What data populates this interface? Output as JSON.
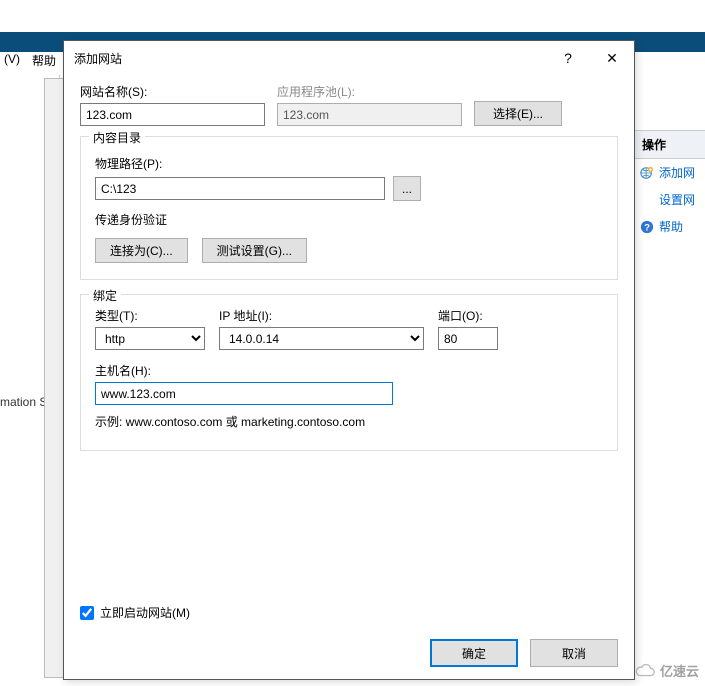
{
  "topMenu": {
    "item1": "(V)",
    "item2": "帮助"
  },
  "leftPaneTruncated": "mation S",
  "rightPanel": {
    "header": "操作",
    "addSite": "添加网",
    "setSite": "设置网",
    "help": "帮助"
  },
  "dialog": {
    "title": "添加网站",
    "helpGlyph": "?",
    "closeGlyph": "✕",
    "siteNameLabel": "网站名称(S):",
    "siteNameValue": "123.com",
    "appPoolLabel": "应用程序池(L):",
    "appPoolValue": "123.com",
    "selectBtn": "选择(E)...",
    "contentDir": {
      "legend": "内容目录",
      "physicalPathLabel": "物理路径(P):",
      "physicalPathValue": "C:\\123",
      "browseBtn": "...",
      "passthroughLabel": "传递身份验证",
      "connectAsBtn": "连接为(C)...",
      "testSettingsBtn": "测试设置(G)..."
    },
    "binding": {
      "legend": "绑定",
      "typeLabel": "类型(T):",
      "typeValue": "http",
      "ipLabel": "IP 地址(I):",
      "ipValue": "14.0.0.14",
      "portLabel": "端口(O):",
      "portValue": "80",
      "hostLabel": "主机名(H):",
      "hostValue": "www.123.com",
      "example": "示例: www.contoso.com 或 marketing.contoso.com"
    },
    "startImmediately": "立即启动网站(M)",
    "ok": "确定",
    "cancel": "取消"
  },
  "watermark": "亿速云"
}
